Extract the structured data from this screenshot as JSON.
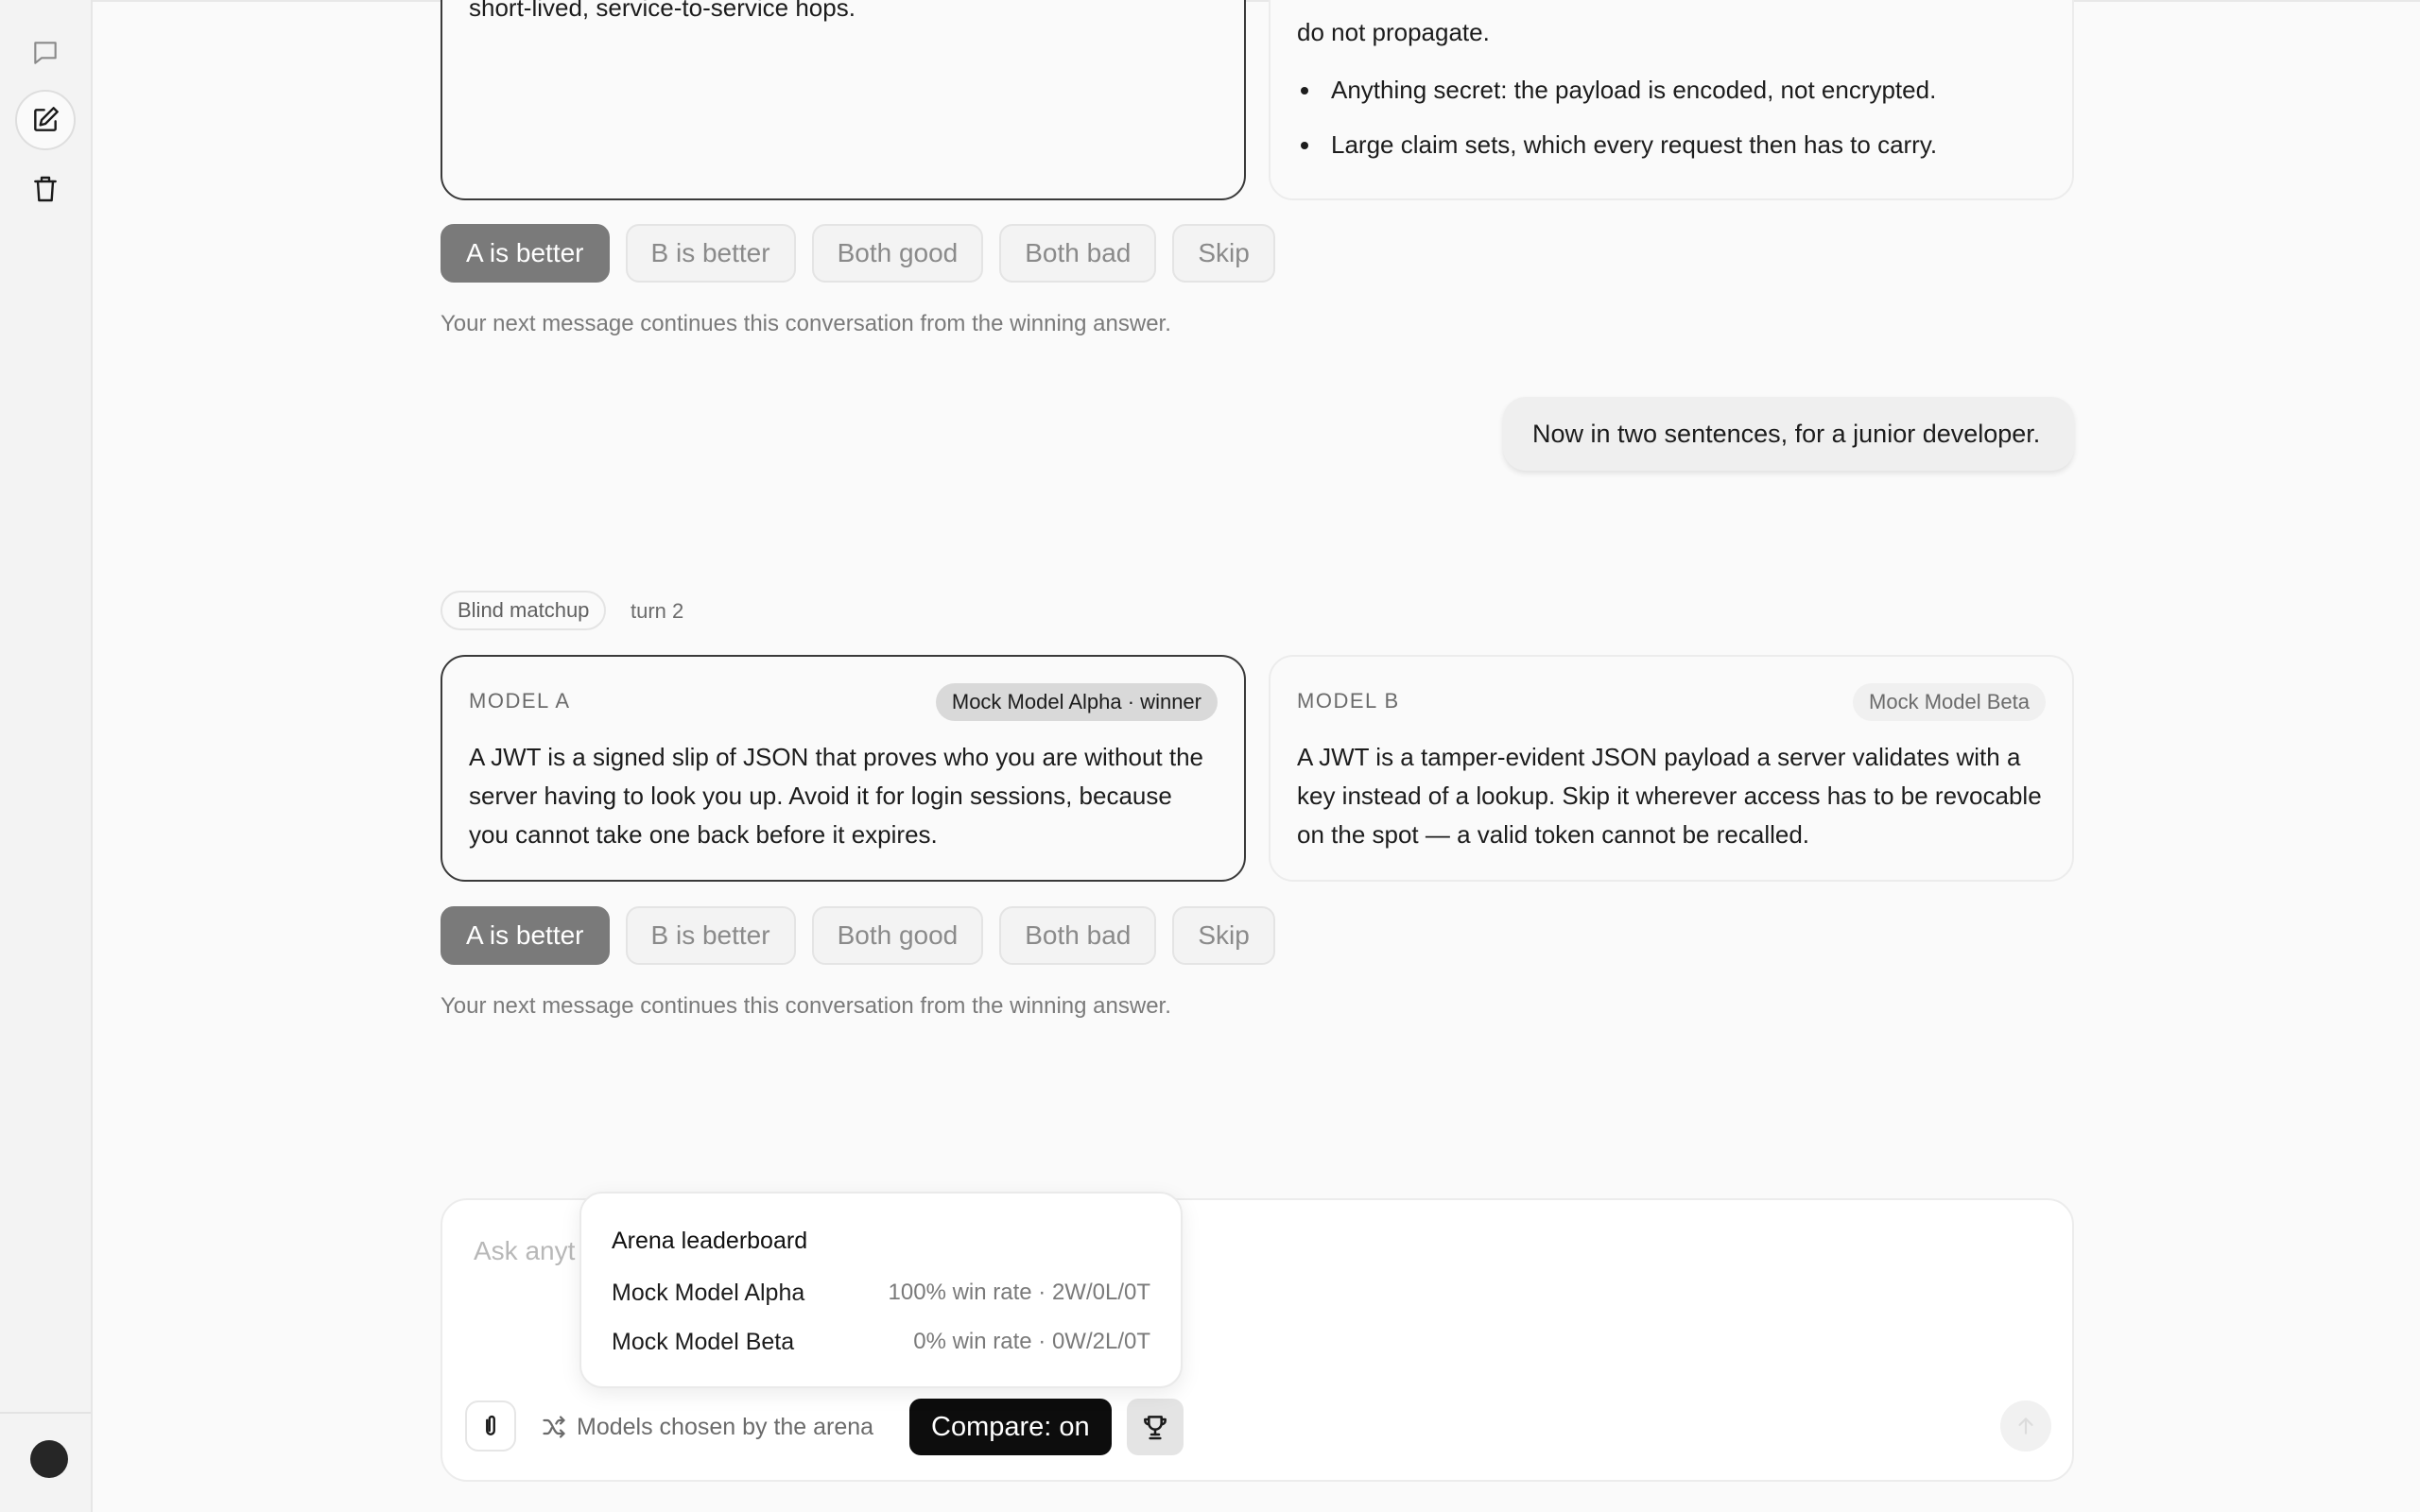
{
  "sidebar": {
    "icons": [
      "chat-bubble-icon",
      "edit-icon",
      "trash-icon"
    ]
  },
  "turn1": {
    "card_a": {
      "text_tail": "short-lived, service-to-service hops."
    },
    "card_b": {
      "text_tail": "do not propagate.",
      "bullets": [
        "Anything secret: the payload is encoded, not encrypted.",
        "Large claim sets, which every request then has to carry."
      ]
    },
    "votes": [
      "A is better",
      "B is better",
      "Both good",
      "Both bad",
      "Skip"
    ],
    "selected_vote": "A is better",
    "note": "Your next message continues this conversation from the winning answer."
  },
  "user_message": "Now in two sentences, for a junior developer.",
  "turn2": {
    "matchup_chip": "Blind matchup",
    "turn_label": "turn 2",
    "card_a": {
      "label": "MODEL A",
      "reveal": "Mock Model Alpha · winner",
      "text": "A JWT is a signed slip of JSON that proves who you are without the server having to look you up. Avoid it for login sessions, because you cannot take one back before it expires."
    },
    "card_b": {
      "label": "MODEL B",
      "reveal": "Mock Model Beta",
      "text": "A JWT is a tamper-evident JSON payload a server validates with a key instead of a lookup. Skip it wherever access has to be revocable on the spot — a valid token cannot be recalled."
    },
    "votes": [
      "A is better",
      "B is better",
      "Both good",
      "Both bad",
      "Skip"
    ],
    "selected_vote": "A is better",
    "note": "Your next message continues this conversation from the winning answer."
  },
  "composer": {
    "placeholder_visible": "Ask anyt",
    "arena_label": "Models chosen by the arena",
    "compare_label": "Compare: on"
  },
  "leaderboard": {
    "title": "Arena leaderboard",
    "rows": [
      {
        "name": "Mock Model Alpha",
        "stat": "100% win rate · 2W/0L/0T"
      },
      {
        "name": "Mock Model Beta",
        "stat": "0% win rate · 0W/2L/0T"
      }
    ]
  },
  "colors": {
    "accent_dark": "#0d0d0d",
    "selected_vote": "#7a7a7a",
    "card_border_winner": "#3a3a3a",
    "background": "#fafafa"
  }
}
